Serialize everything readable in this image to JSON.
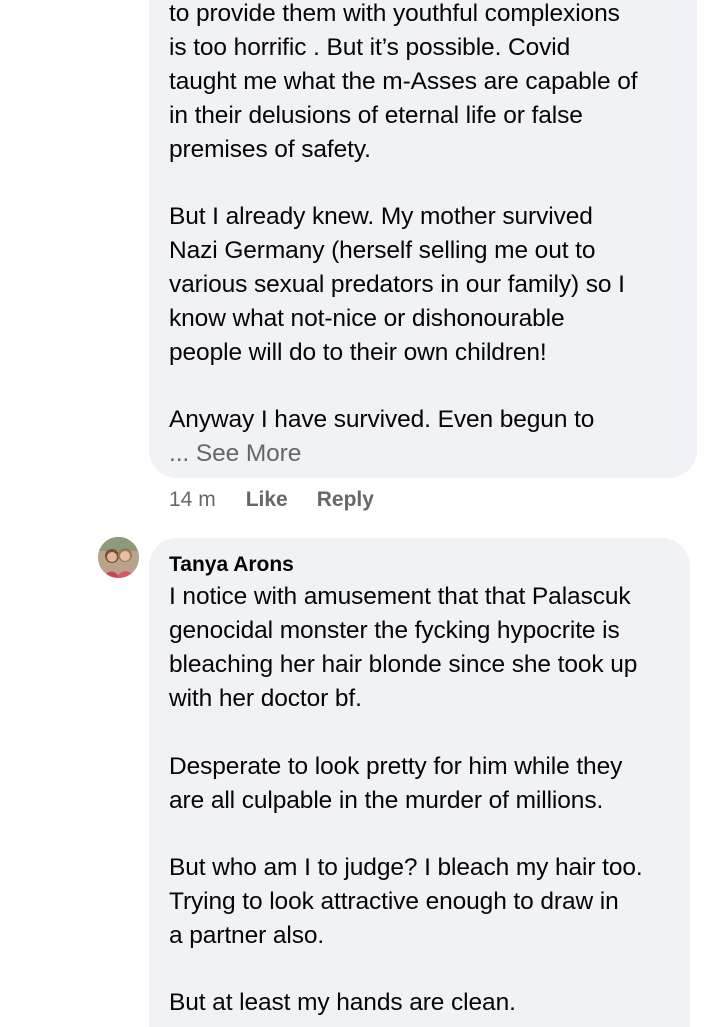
{
  "comment_one": {
    "lines": [
      "to provide them with youthful complexions",
      "is too horrific .  But it’s possible.  Covid",
      "taught me what the m-Asses are capable of",
      "in their delusions of eternal life or false",
      "premises of safety.",
      "",
      "But I already knew.  My mother survived",
      "Nazi Germany (herself selling me out to",
      "various sexual predators in our family) so I",
      "know what not-nice or dishonourable",
      "people will do to their own children!",
      "",
      "Anyway I have survived.  Even begun to"
    ],
    "see_more": "... See More",
    "time": "14 m",
    "like_label": "Like",
    "reply_label": "Reply"
  },
  "comment_two": {
    "author": "Tanya Arons",
    "avatar_icon": "profile-photo",
    "lines": [
      "I notice with amusement that that Palascuk",
      "genocidal monster the fycking  hypocrite is",
      "bleaching her hair blonde since she took up",
      "with her doctor bf.",
      "",
      "Desperate to look pretty for him while they",
      "are all culpable in the murder of millions.",
      "",
      "But who am I to judge? I bleach my hair too.",
      "Trying to look attractive enough to  draw in",
      "a partner also.",
      "",
      "But at least my hands are clean."
    ]
  },
  "colors": {
    "bubble": "#f0f2f5",
    "text": "#050505",
    "secondary": "#65676b"
  }
}
